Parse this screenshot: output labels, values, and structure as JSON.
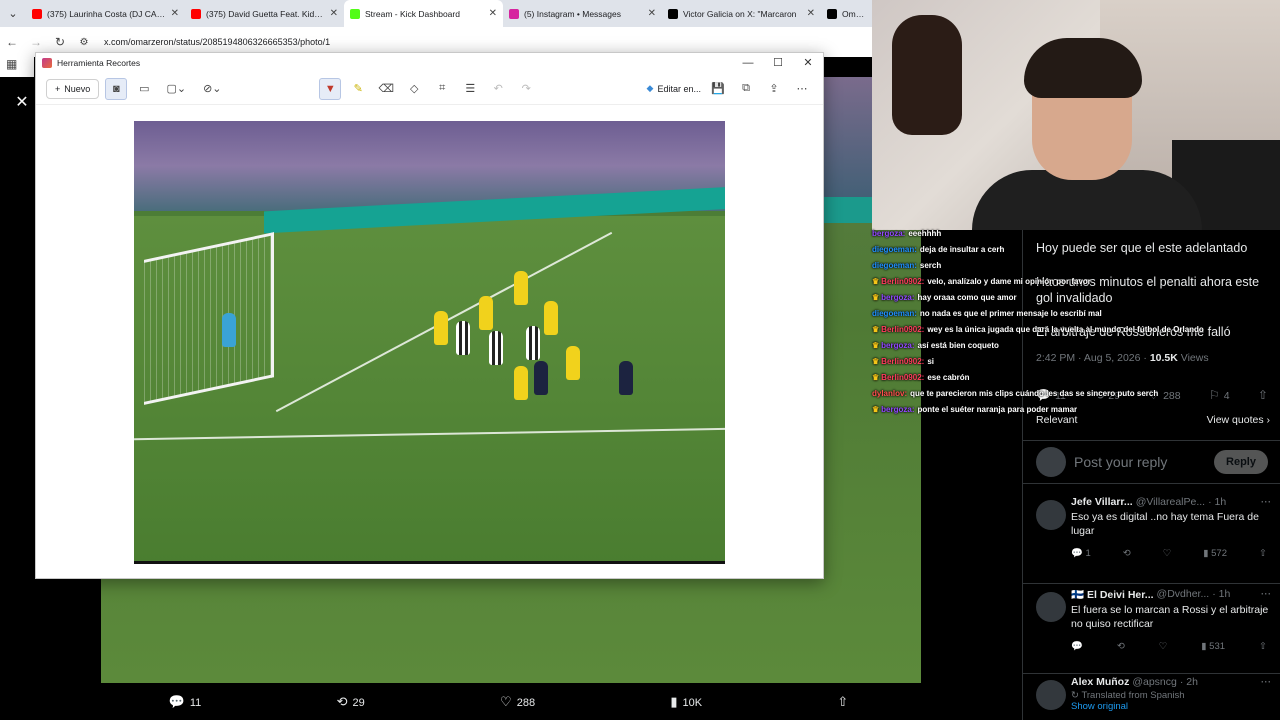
{
  "browser": {
    "tabs": [
      {
        "title": "(375) Laurinha Costa (DJ CABEL",
        "favicon_color": "#ff0000"
      },
      {
        "title": "(375) David Guetta Feat. Kid Cu",
        "favicon_color": "#ff0000"
      },
      {
        "title": "Stream - Kick Dashboard",
        "favicon_color": "#53fc18"
      },
      {
        "title": "(5) Instagram • Messages",
        "favicon_color": "#d6249f"
      },
      {
        "title": "Victor Galicia on X: \"Marcaron",
        "favicon_color": "#000000"
      },
      {
        "title": "Omar Ze",
        "favicon_color": "#000000"
      }
    ],
    "url": "x.com/omarzeron/status/2085194806326665353/photo/1"
  },
  "snip": {
    "title": "Herramienta Recortes",
    "new_label": "Nuevo",
    "edit_label": "Editar en..."
  },
  "photo_actions": {
    "replies": "11",
    "reposts": "29",
    "likes": "288",
    "views": "10K"
  },
  "chat": [
    {
      "user": "bergoza",
      "user_color": "#9146ff",
      "text": "eeehhhh",
      "badge": ""
    },
    {
      "user": "diegoeman",
      "user_color": "#1e90ff",
      "text": "deja de insultar a cerh",
      "badge": ""
    },
    {
      "user": "diegoeman",
      "user_color": "#1e90ff",
      "text": "serch",
      "badge": ""
    },
    {
      "user": "Berlin0902",
      "user_color": "#ff3b5c",
      "text": "velo, analízalo y dame mi opinión por favor",
      "badge": "♛"
    },
    {
      "user": "bergoza",
      "user_color": "#9146ff",
      "text": "hay oraaa como que amor",
      "badge": "♛"
    },
    {
      "user": "diegoeman",
      "user_color": "#1e90ff",
      "text": "no nada es que el primer mensaje lo escribí mal",
      "badge": ""
    },
    {
      "user": "Berlin0902",
      "user_color": "#ff3b5c",
      "text": "wey es la única jugada que dará la vuelta al mundo del fútbol de Orlando",
      "badge": "♛"
    },
    {
      "user": "bergoza",
      "user_color": "#9146ff",
      "text": "así está bien coqueto",
      "badge": "♛"
    },
    {
      "user": "Berlin0902",
      "user_color": "#ff3b5c",
      "text": "si",
      "badge": "♛"
    },
    {
      "user": "Berlin0902",
      "user_color": "#ff3b5c",
      "text": "ese cabrón",
      "badge": "♛"
    },
    {
      "user": "dylanlov",
      "user_color": "#ff4d4d",
      "text": "que te parecieron mis clips cuándo les das se sincero puto serch",
      "badge": ""
    },
    {
      "user": "bergoza",
      "user_color": "#9146ff",
      "text": "ponte el suéter naranja para poder mamar",
      "badge": "♛"
    }
  ],
  "tweet": {
    "text_lines": [
      "Hoy puede ser que el este adelantado",
      "Hace unos minutos el penalti ahora este gol invalidado",
      "El arbitraje de Rossoneros me falló"
    ],
    "time": "2:42 PM · Aug 5, 2026 · ",
    "views_count": "10.5K",
    "views_label": " Views",
    "replies": "11",
    "reposts": "29",
    "likes": "288",
    "bookmarks": "4",
    "relevant": "Relevant",
    "view_quotes": "View quotes",
    "reply_placeholder": "Post your reply",
    "reply_button": "Reply"
  },
  "replies": [
    {
      "name": "Jefe Villarr...",
      "handle": "@VillarealPe...",
      "time": "· 1h",
      "text": "Eso ya es digital ..no hay tema Fuera de lugar",
      "r": "1",
      "rt": "",
      "l": "",
      "v": "572"
    },
    {
      "name": "🇫🇮 El Deivi Her...",
      "handle": "@Dvdher...",
      "time": "· 1h",
      "text": "El fuera se lo marcan a Rossi y el arbitraje no quiso rectificar",
      "r": "",
      "rt": "",
      "l": "",
      "v": "531"
    },
    {
      "name": "Alex Muñoz",
      "handle": "@apsncg",
      "time": "· 2h",
      "text": "",
      "translated": "Translated from Spanish",
      "show_original": "Show original"
    }
  ]
}
